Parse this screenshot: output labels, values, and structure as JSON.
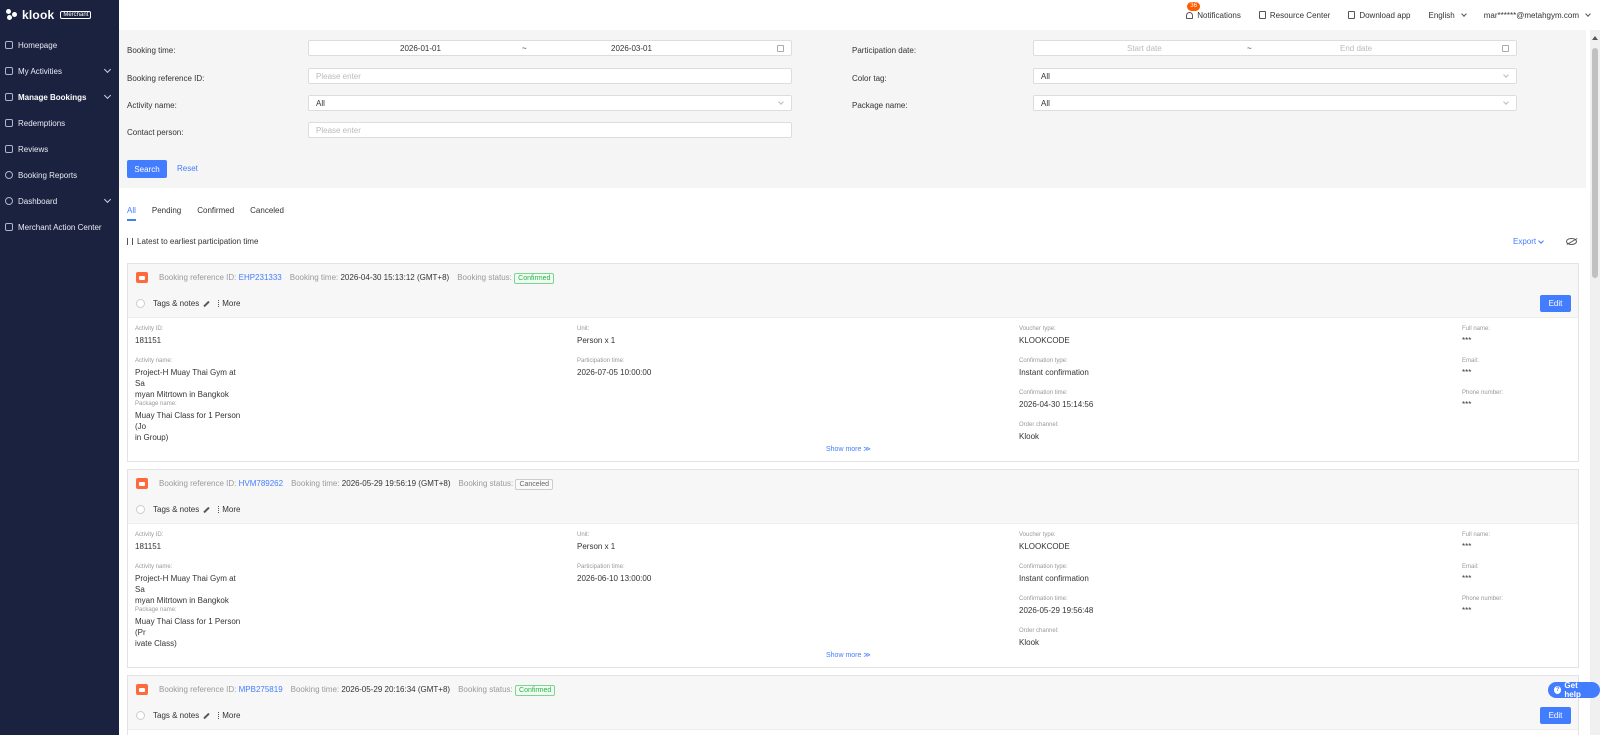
{
  "sidebar": {
    "logo_text": "klook",
    "logo_badge": "Merchant",
    "items": [
      {
        "label": "Homepage"
      },
      {
        "label": "My Activities"
      },
      {
        "label": "Manage Bookings"
      },
      {
        "label": "Redemptions"
      },
      {
        "label": "Reviews"
      },
      {
        "label": "Booking Reports"
      },
      {
        "label": "Dashboard"
      },
      {
        "label": "Merchant Action Center"
      }
    ]
  },
  "topbar": {
    "notifications_count": "36",
    "notifications_label": "Notifications",
    "resource_center": "Resource Center",
    "download_app": "Download app",
    "language": "English",
    "account": "mar******@metahgym.com"
  },
  "filters": {
    "booking_time_label": "Booking time:",
    "booking_time_start": "2026-01-01",
    "booking_time_end": "2026-03-01",
    "range_sep": "~",
    "participation_date_label": "Participation date:",
    "participation_start_ph": "Start date",
    "participation_end_ph": "End date",
    "booking_ref_label": "Booking reference ID:",
    "booking_ref_ph": "Please enter",
    "color_tag_label": "Color tag:",
    "color_tag_value": "All",
    "activity_name_label": "Activity name:",
    "activity_name_value": "All",
    "package_name_label": "Package name:",
    "package_name_value": "All",
    "contact_person_label": "Contact person:",
    "contact_person_ph": "Please enter",
    "search_button": "Search",
    "reset_button": "Reset"
  },
  "tabs": [
    "All",
    "Pending",
    "Confirmed",
    "Canceled"
  ],
  "sort_label": "Latest to earliest participation time",
  "export_label": "Export",
  "labels": {
    "booking_ref": "Booking reference ID:",
    "booking_time": "Booking time:",
    "booking_status": "Booking status:",
    "tags_notes": "Tags & notes",
    "more": "More",
    "edit": "Edit",
    "activity_id": "Activity ID:",
    "activity_name": "Activity name:",
    "package_name": "Package name:",
    "unit": "Unit:",
    "participation_time": "Participation time:",
    "voucher_type": "Voucher type:",
    "confirmation_type": "Confirmation type:",
    "confirmation_time": "Confirmation time:",
    "order_channel": "Order channel:",
    "full_name": "Full name:",
    "email": "Email:",
    "phone": "Phone number:",
    "show_more": "Show more ≫"
  },
  "bookings": [
    {
      "ref": "EHP231333",
      "booking_time": "2026-04-30 15:13:12 (GMT+8)",
      "status": "Confirmed",
      "activity_id": "181151",
      "activity_name_1": "Project-H Muay Thai Gym at Sa",
      "activity_name_2": "myan Mitrtown in Bangkok",
      "package_name_1": "Muay Thai Class for 1 Person (Jo",
      "package_name_2": "in Group)",
      "unit": "Person x 1",
      "participation_time": "2026-07-05 10:00:00",
      "voucher_type": "KLOOKCODE",
      "confirmation_type": "Instant confirmation",
      "confirmation_time": "2026-04-30 15:14:56",
      "order_channel": "Klook",
      "full_name": "***",
      "email": "***",
      "phone": "***"
    },
    {
      "ref": "HVM789262",
      "booking_time": "2026-05-29 19:56:19 (GMT+8)",
      "status": "Canceled",
      "activity_id": "181151",
      "activity_name_1": "Project-H Muay Thai Gym at Sa",
      "activity_name_2": "myan Mitrtown in Bangkok",
      "package_name_1": "Muay Thai Class for 1 Person (Pr",
      "package_name_2": "ivate Class)",
      "unit": "Person x 1",
      "participation_time": "2026-06-10 13:00:00",
      "voucher_type": "KLOOKCODE",
      "confirmation_type": "Instant confirmation",
      "confirmation_time": "2026-05-29 19:56:48",
      "order_channel": "Klook",
      "full_name": "***",
      "email": "***",
      "phone": "***"
    },
    {
      "ref": "MPB275819",
      "booking_time": "2026-05-29 20:16:34 (GMT+8)",
      "status": "Confirmed"
    }
  ],
  "get_help": "Get help",
  "colors": {
    "accent": "#437dff",
    "sidebar": "#1b2240",
    "confirmed": "#28b446",
    "badge": "#ff5b00"
  }
}
